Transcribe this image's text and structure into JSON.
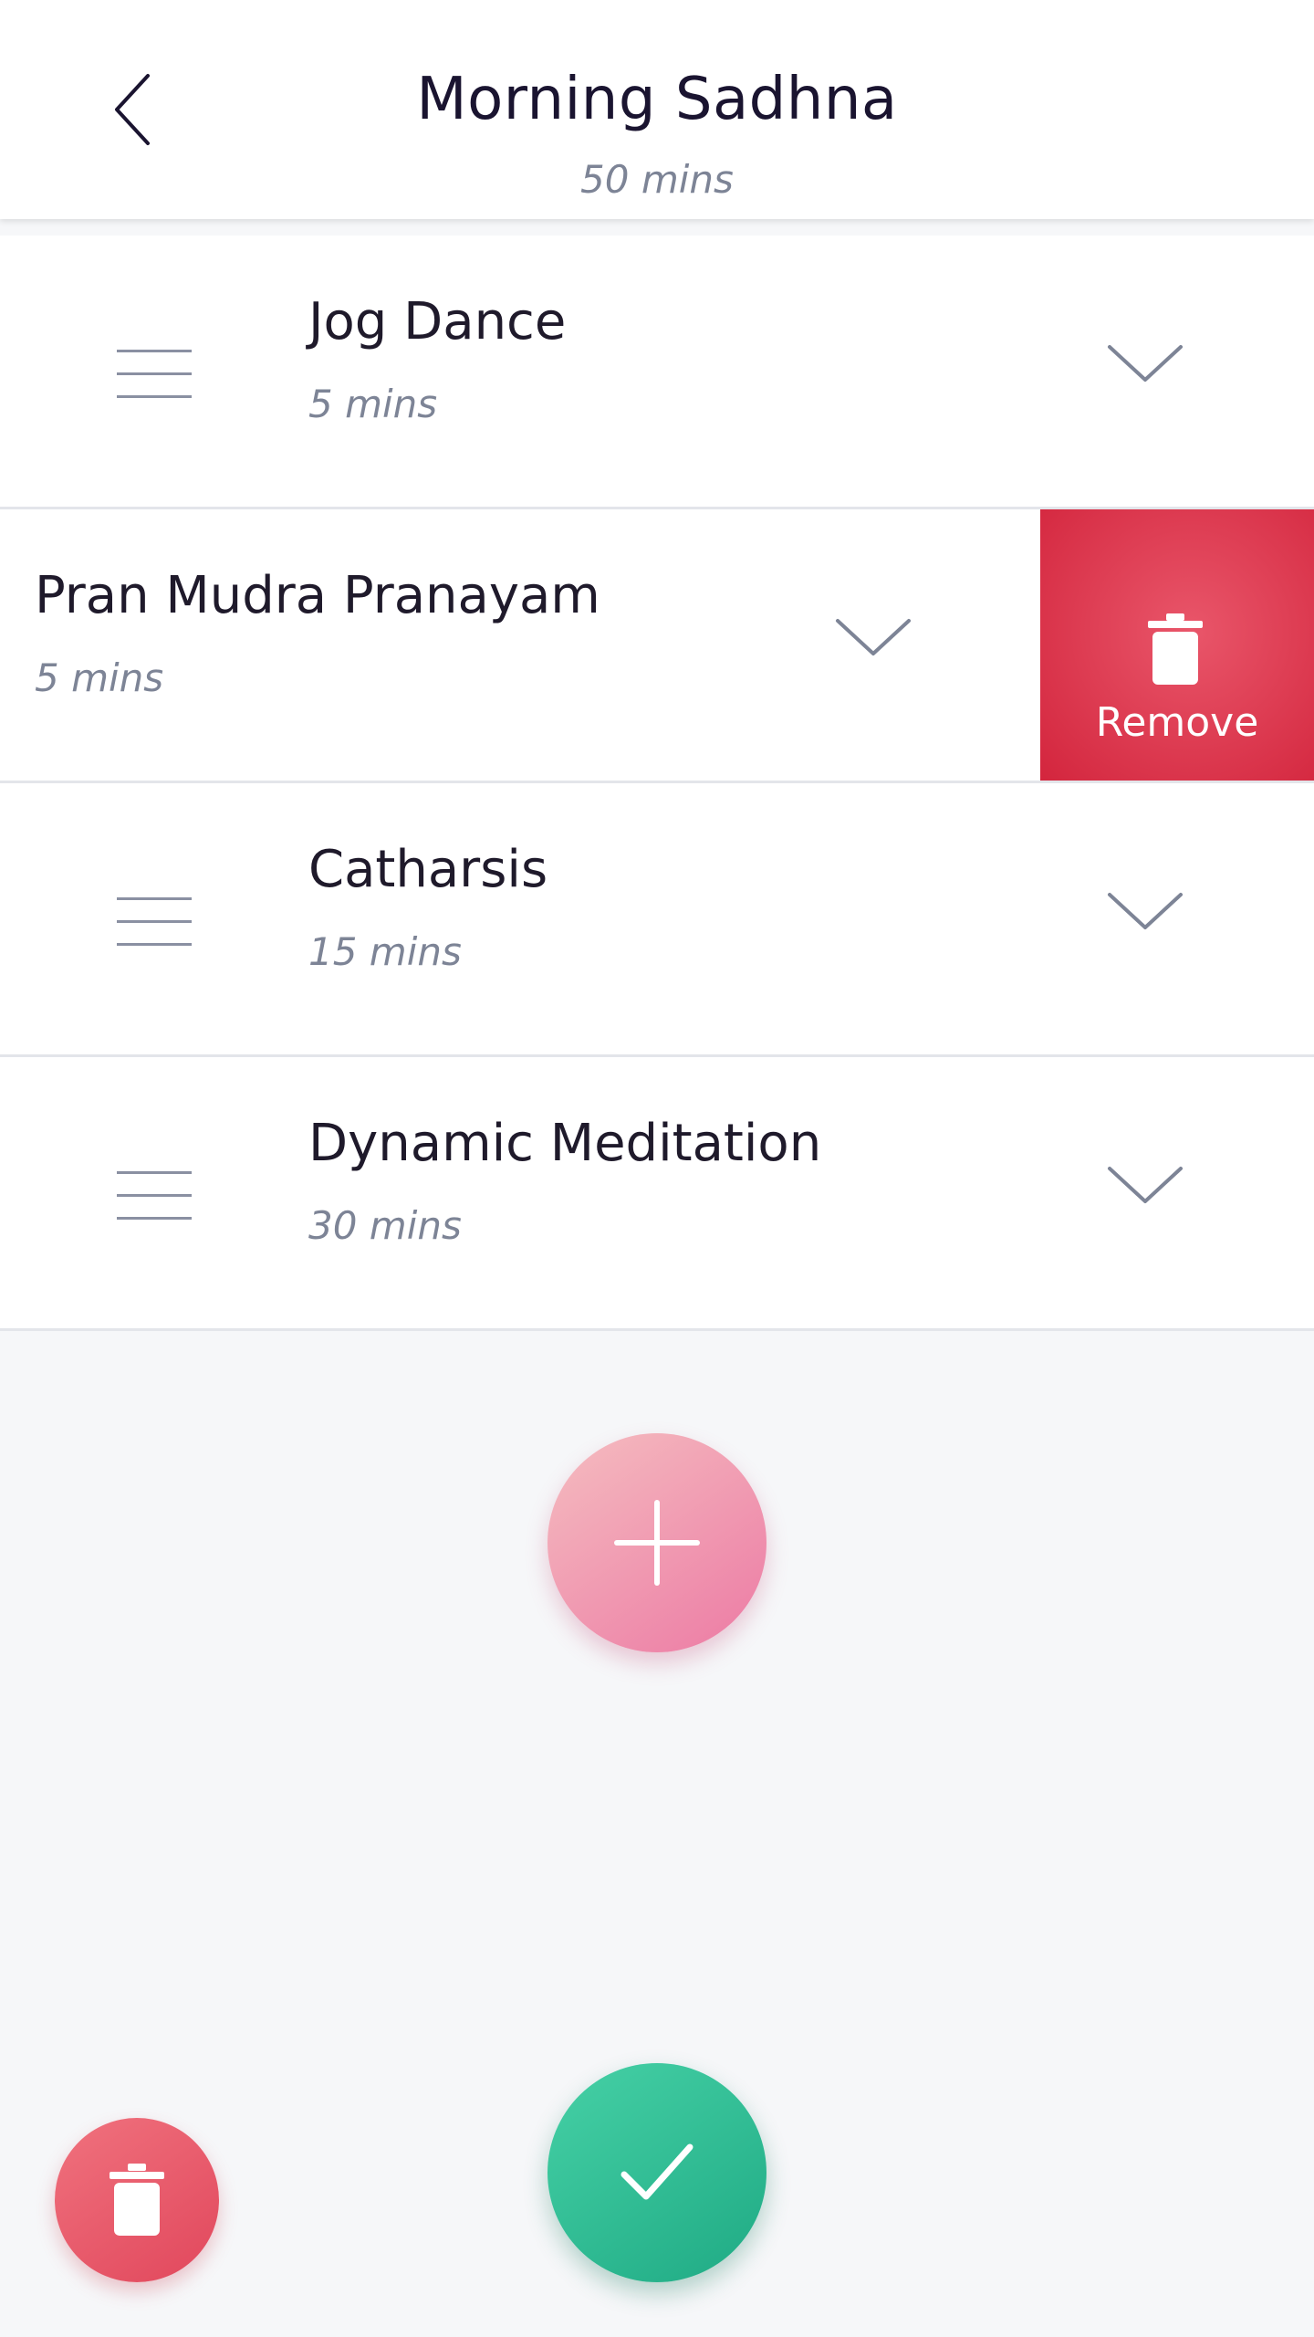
{
  "header": {
    "title": "Morning Sadhna",
    "subtitle": "50 mins"
  },
  "items": [
    {
      "name": "Jog Dance",
      "duration": "5 mins"
    },
    {
      "name": "Pran Mudra Pranayam",
      "duration": "5 mins",
      "swiped": true,
      "action_label": "Remove"
    },
    {
      "name": "Catharsis",
      "duration": "15 mins"
    },
    {
      "name": "Dynamic Meditation",
      "duration": "30 mins"
    }
  ],
  "icons": {
    "back": "chevron-left-icon",
    "expand": "chevron-down-icon",
    "drag": "drag-handle-icon",
    "remove": "trash-icon",
    "add": "plus-icon",
    "confirm": "check-icon",
    "delete": "trash-icon"
  },
  "colors": {
    "remove": "#d3253d",
    "add": "#ec7aa4",
    "confirm": "#1faa84",
    "delete": "#e1475c",
    "secondary_text": "#7d8496"
  }
}
